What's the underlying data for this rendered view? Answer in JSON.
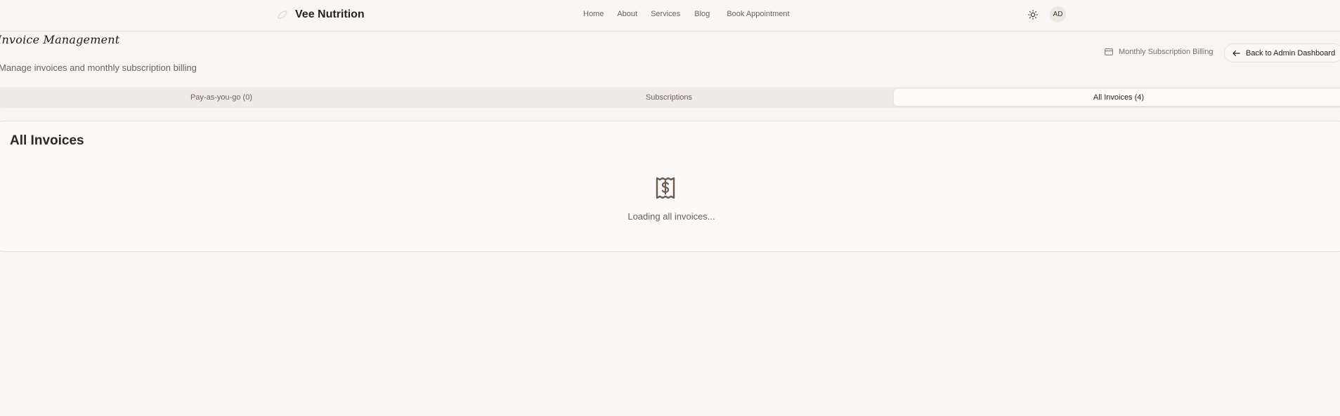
{
  "brand": {
    "name": "Vee Nutrition",
    "logo_icon": "leaf-icon"
  },
  "nav": {
    "items": [
      {
        "label": "Home"
      },
      {
        "label": "About"
      },
      {
        "label": "Services"
      },
      {
        "label": "Blog"
      },
      {
        "label": "Book Appointment"
      }
    ]
  },
  "header": {
    "theme_icon": "sun-icon",
    "avatar_initials": "AD"
  },
  "page": {
    "title": "Invoice Management",
    "subtitle": "Manage invoices and monthly subscription billing",
    "billing_link": "Monthly Subscription Billing",
    "back_button": "Back to Admin Dashboard"
  },
  "tabs": [
    {
      "label": "Pay-as-you-go (0)",
      "active": false
    },
    {
      "label": "Subscriptions",
      "active": false
    },
    {
      "label": "All Invoices (4)",
      "active": true
    }
  ],
  "card": {
    "title": "All Invoices",
    "empty_icon": "receipt-dollar-icon",
    "loading_text": "Loading all invoices..."
  },
  "colors": {
    "background": "#f7f6f4",
    "text_primary": "#2b241f",
    "text_muted": "#6a6058",
    "accent_icon": "#6d5d50"
  }
}
